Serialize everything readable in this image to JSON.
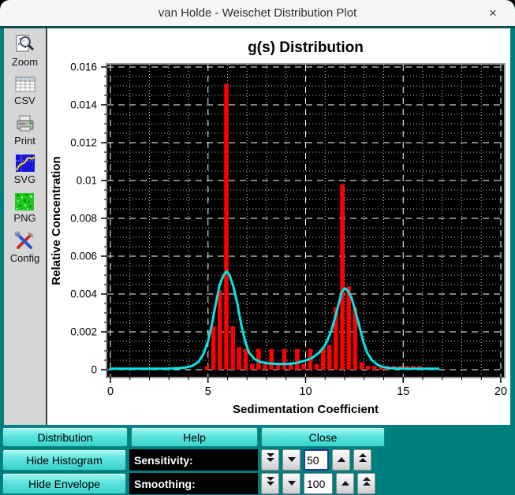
{
  "window": {
    "title": "van Holde - Weischet Distribution Plot",
    "close": "×"
  },
  "toolbar": {
    "items": [
      {
        "id": "zoom",
        "label": "Zoom"
      },
      {
        "id": "csv",
        "label": "CSV"
      },
      {
        "id": "print",
        "label": "Print"
      },
      {
        "id": "svg",
        "label": "SVG"
      },
      {
        "id": "png",
        "label": "PNG"
      },
      {
        "id": "config",
        "label": "Config"
      }
    ]
  },
  "chart_data": {
    "type": "bar",
    "title": "g(s) Distribution",
    "xlabel": "Sedimentation Coefficient",
    "ylabel": "Relative Concentration",
    "xlim": [
      0,
      20
    ],
    "ylim": [
      0,
      0.016
    ],
    "x_major_ticks": [
      0,
      5,
      10,
      15,
      20
    ],
    "x_tick_labels": [
      "0",
      "5",
      "10",
      "15",
      "20"
    ],
    "x_minor_step": 1,
    "y_major_ticks": [
      0,
      0.002,
      0.004,
      0.006,
      0.008,
      0.01,
      0.012,
      0.014,
      0.016
    ],
    "y_tick_labels": [
      "0",
      "0.002",
      "0.004",
      "0.006",
      "0.008",
      "0.01",
      "0.012",
      "0.014",
      "0.016"
    ],
    "y_minor_step": 0.0005,
    "grid": "major white dashed, minor white dotted, on black background",
    "legend": "none",
    "colors": {
      "bars": "#ff0000",
      "envelope": "#00e6e6",
      "plot_bg": "#000000",
      "grid_major": "#ffffff",
      "grid_minor": "#c8c8c8",
      "text": "#000000"
    },
    "bars": [
      [
        4.95,
        0.0002
      ],
      [
        5.28,
        0.0023
      ],
      [
        5.61,
        0.0042
      ],
      [
        5.94,
        0.0151
      ],
      [
        6.27,
        0.0023
      ],
      [
        6.6,
        0.0012
      ],
      [
        6.93,
        0.0011
      ],
      [
        7.26,
        0.0003
      ],
      [
        7.59,
        0.0011
      ],
      [
        7.92,
        0.0003
      ],
      [
        8.25,
        0.0011
      ],
      [
        8.58,
        0.0003
      ],
      [
        8.91,
        0.0011
      ],
      [
        9.24,
        0.0003
      ],
      [
        9.57,
        0.0011
      ],
      [
        9.9,
        0.0003
      ],
      [
        10.23,
        0.0011
      ],
      [
        10.56,
        0.0003
      ],
      [
        10.89,
        0.0011
      ],
      [
        11.22,
        0.0013
      ],
      [
        11.55,
        0.0033
      ],
      [
        11.88,
        0.0098
      ],
      [
        12.21,
        0.0044
      ],
      [
        12.54,
        0.0033
      ],
      [
        12.87,
        0.0004
      ],
      [
        13.2,
        0.0002
      ],
      [
        13.53,
        0.0002
      ],
      [
        13.86,
        0.0002
      ],
      [
        14.19,
        0.0002
      ],
      [
        14.52,
        0.0002
      ],
      [
        14.85,
        0.0002
      ],
      [
        15.18,
        0.0002
      ],
      [
        15.51,
        0.0002
      ],
      [
        15.84,
        0.0002
      ],
      [
        16.17,
        0.0001
      ],
      [
        16.5,
        0.0001
      ]
    ],
    "envelope": [
      [
        0,
        5e-05
      ],
      [
        0.8,
        5e-05
      ],
      [
        1.6,
        5e-05
      ],
      [
        2.4,
        5e-05
      ],
      [
        3.0,
        6e-05
      ],
      [
        3.5,
        8e-05
      ],
      [
        3.9,
        0.00012
      ],
      [
        4.2,
        0.0002
      ],
      [
        4.5,
        0.0004
      ],
      [
        4.75,
        0.0008
      ],
      [
        5.0,
        0.0015
      ],
      [
        5.2,
        0.0024
      ],
      [
        5.4,
        0.0035
      ],
      [
        5.6,
        0.0045
      ],
      [
        5.8,
        0.005
      ],
      [
        5.95,
        0.0052
      ],
      [
        6.1,
        0.005
      ],
      [
        6.3,
        0.0044
      ],
      [
        6.5,
        0.0035
      ],
      [
        6.7,
        0.0024
      ],
      [
        6.9,
        0.0015
      ],
      [
        7.1,
        0.0009
      ],
      [
        7.4,
        0.00055
      ],
      [
        7.7,
        0.0004
      ],
      [
        8.1,
        0.00033
      ],
      [
        8.6,
        0.0003
      ],
      [
        9.1,
        0.0003
      ],
      [
        9.5,
        0.00035
      ],
      [
        9.9,
        0.00045
      ],
      [
        10.3,
        0.0006
      ],
      [
        10.7,
        0.0009
      ],
      [
        11.0,
        0.0013
      ],
      [
        11.3,
        0.002
      ],
      [
        11.5,
        0.0027
      ],
      [
        11.7,
        0.0035
      ],
      [
        11.85,
        0.0041
      ],
      [
        12.0,
        0.0043
      ],
      [
        12.15,
        0.0042
      ],
      [
        12.35,
        0.0038
      ],
      [
        12.55,
        0.0031
      ],
      [
        12.75,
        0.0023
      ],
      [
        12.95,
        0.0015
      ],
      [
        13.15,
        0.0009
      ],
      [
        13.4,
        0.0005
      ],
      [
        13.7,
        0.00025
      ],
      [
        14.0,
        0.00013
      ],
      [
        14.4,
        8e-05
      ],
      [
        14.9,
        6e-05
      ],
      [
        15.5,
        5e-05
      ],
      [
        16.1,
        5e-05
      ],
      [
        16.8,
        5e-05
      ]
    ]
  },
  "controls": {
    "buttons_row": [
      {
        "label": "Distribution"
      },
      {
        "label": "Help"
      },
      {
        "label": "Close"
      }
    ],
    "histogram_row": {
      "button": "Hide Histogram",
      "label": "Sensitivity:",
      "value": "50"
    },
    "envelope_row": {
      "button": "Hide Envelope",
      "label": "Smoothing:",
      "value": "100"
    }
  }
}
